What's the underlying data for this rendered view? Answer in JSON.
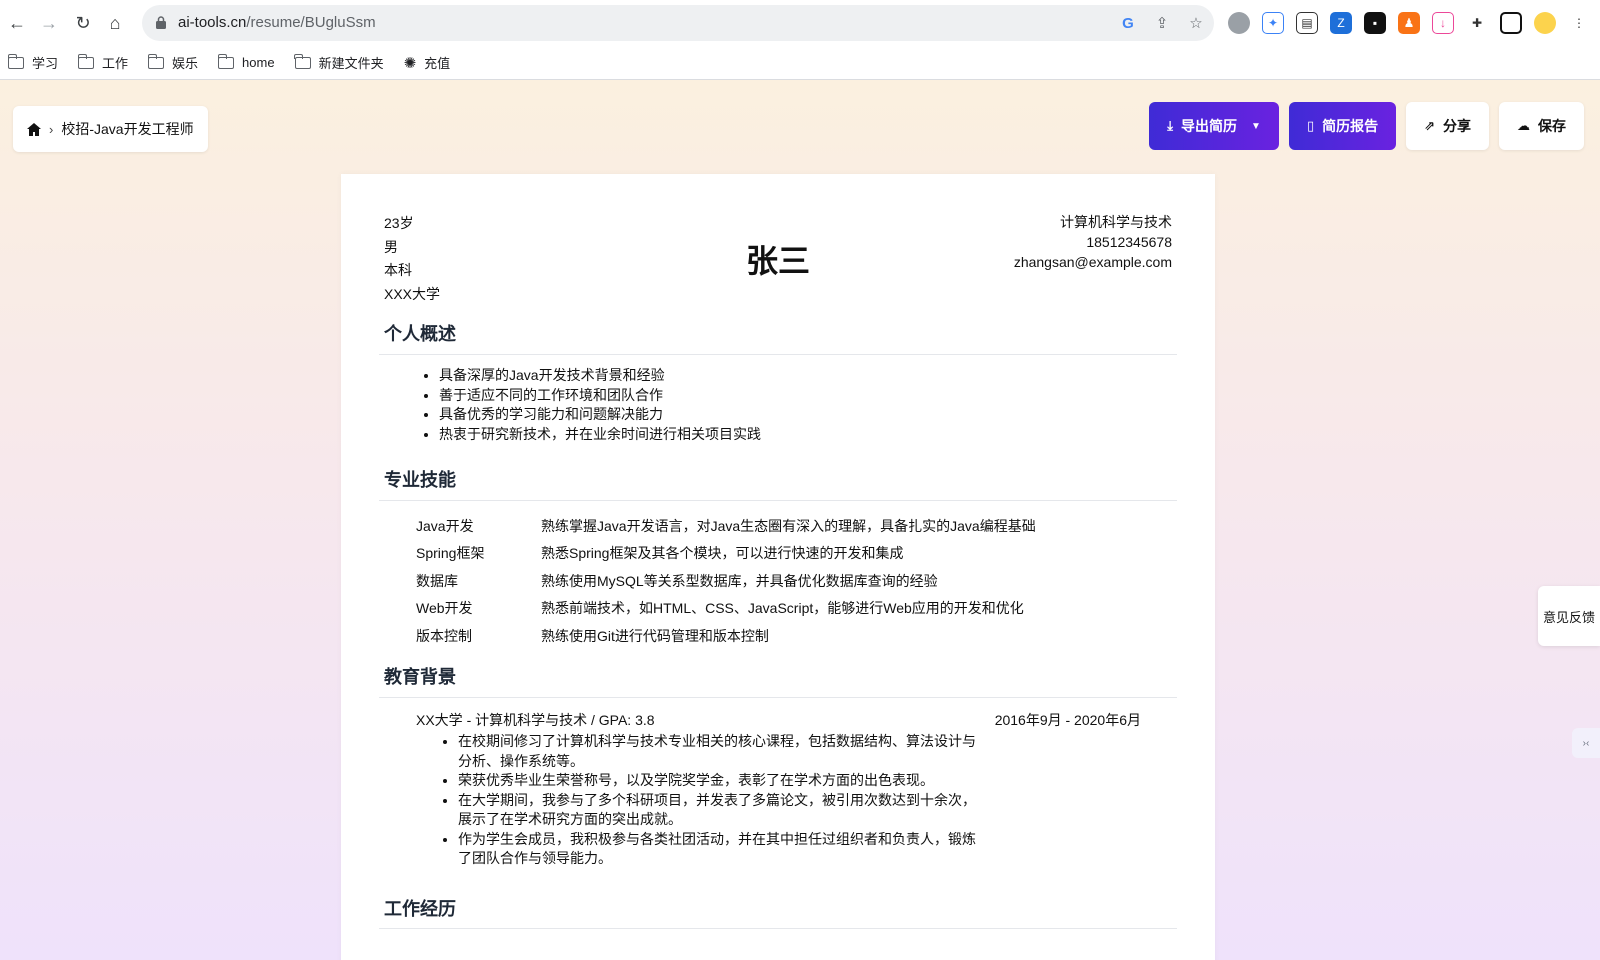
{
  "browser": {
    "url_host": "ai-tools.cn",
    "url_path": "/resume/BUgluSsm",
    "bookmarks": [
      "学习",
      "工作",
      "娱乐",
      "home",
      "新建文件夹",
      "充值"
    ]
  },
  "breadcrumb": {
    "title": "校招-Java开发工程师"
  },
  "toolbar": {
    "export_label": "导出简历",
    "report_label": "简历报告",
    "share_label": "分享",
    "save_label": "保存"
  },
  "resume": {
    "age": "23岁",
    "gender": "男",
    "degree": "本科",
    "school": "XXX大学",
    "name": "张三",
    "major": "计算机科学与技术",
    "phone": "18512345678",
    "email": "zhangsan@example.com",
    "summary_title": "个人概述",
    "summary": [
      "具备深厚的Java开发技术背景和经验",
      "善于适应不同的工作环境和团队合作",
      "具备优秀的学习能力和问题解决能力",
      "热衷于研究新技术，并在业余时间进行相关项目实践"
    ],
    "skills_title": "专业技能",
    "skills": [
      {
        "name": "Java开发",
        "desc": "熟练掌握Java开发语言，对Java生态圈有深入的理解，具备扎实的Java编程基础"
      },
      {
        "name": "Spring框架",
        "desc": "熟悉Spring框架及其各个模块，可以进行快速的开发和集成"
      },
      {
        "name": "数据库",
        "desc": "熟练使用MySQL等关系型数据库，并具备优化数据库查询的经验"
      },
      {
        "name": "Web开发",
        "desc": "熟悉前端技术，如HTML、CSS、JavaScript，能够进行Web应用的开发和优化"
      },
      {
        "name": "版本控制",
        "desc": "熟练使用Git进行代码管理和版本控制"
      }
    ],
    "education_title": "教育背景",
    "education": {
      "heading": "XX大学 - 计算机科学与技术 / GPA: 3.8",
      "period": "2016年9月 - 2020年6月",
      "items": [
        "在校期间修习了计算机科学与技术专业相关的核心课程，包括数据结构、算法设计与分析、操作系统等。",
        "荣获优秀毕业生荣誉称号，以及学院奖学金，表彰了在学术方面的出色表现。",
        "在大学期间，我参与了多个科研项目，并发表了多篇论文，被引用次数达到十余次，展示了在学术研究方面的突出成就。",
        "作为学生会成员，我积极参与各类社团活动，并在其中担任过组织者和负责人，锻炼了团队合作与领导能力。"
      ]
    },
    "work_title": "工作经历"
  },
  "feedback_label": "意见反馈"
}
